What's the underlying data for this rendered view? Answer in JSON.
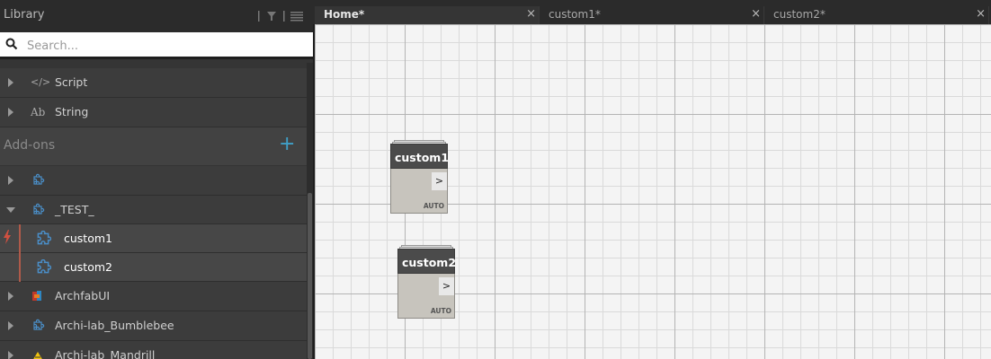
{
  "library": {
    "title": "Library",
    "search_placeholder": "Search...",
    "categories": [
      {
        "label": "Script",
        "icon": "code-tag-icon",
        "icon_text": "</>"
      },
      {
        "label": "String",
        "icon": "text-ab-icon",
        "icon_text": "Ab"
      }
    ],
    "addons": {
      "label": "Add-ons",
      "add_glyph": "+",
      "packages": [
        {
          "label": "",
          "icon": "puzzle-icon",
          "expanded": false
        },
        {
          "label": "_TEST_",
          "icon": "puzzle-icon",
          "expanded": true,
          "children": [
            {
              "label": "custom1",
              "icon": "puzzle-icon"
            },
            {
              "label": "custom2",
              "icon": "puzzle-icon"
            }
          ]
        },
        {
          "label": "ArchfabUI",
          "icon": "archfab-icon",
          "expanded": false
        },
        {
          "label": "Archi-lab_Bumblebee",
          "icon": "puzzle-icon",
          "expanded": false
        },
        {
          "label": "Archi-lab_Mandrill",
          "icon": "mandrill-icon",
          "expanded": false
        }
      ]
    }
  },
  "tabs": [
    {
      "label": "Home*",
      "active": true
    },
    {
      "label": "custom1*",
      "active": false,
      "close": "×"
    },
    {
      "label": "custom2*",
      "active": false,
      "close": "×"
    }
  ],
  "home_tab_close": "×",
  "nodes": [
    {
      "title": "custom1",
      "port": ">",
      "mode": "AUTO"
    },
    {
      "title": "custom2",
      "port": ">",
      "mode": "AUTO"
    }
  ],
  "colors": {
    "accent": "#3fa0c8",
    "selection_bar": "#b05a4a",
    "node_header": "#4b4b4b",
    "node_body": "#c7c4bd"
  }
}
